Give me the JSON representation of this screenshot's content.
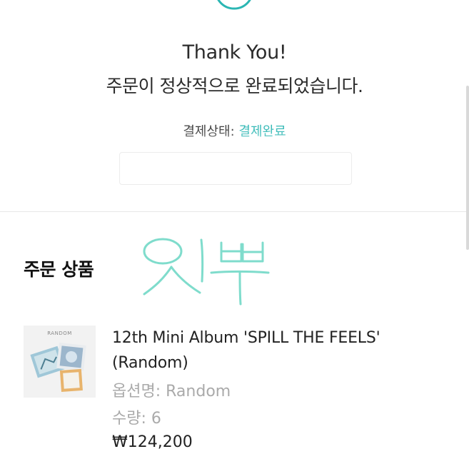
{
  "confirmation": {
    "title": "Thank You!",
    "message": "주문이 정상적으로 완료되었습니다.",
    "payment_status_label": "결제상태:",
    "payment_status_value": "결제완료"
  },
  "order_items": {
    "heading": "주문 상품",
    "handwritten_note": "잇뿌",
    "items": [
      {
        "thumbnail_text": "RANDOM",
        "name": "12th Mini Album 'SPILL THE FEELS' (Random)",
        "option": "옵션명: Random",
        "quantity": "수량: 6",
        "price": "₩124,200"
      }
    ]
  },
  "colors": {
    "accent": "#2bb6b3",
    "handwriting": "#7fdccc"
  }
}
